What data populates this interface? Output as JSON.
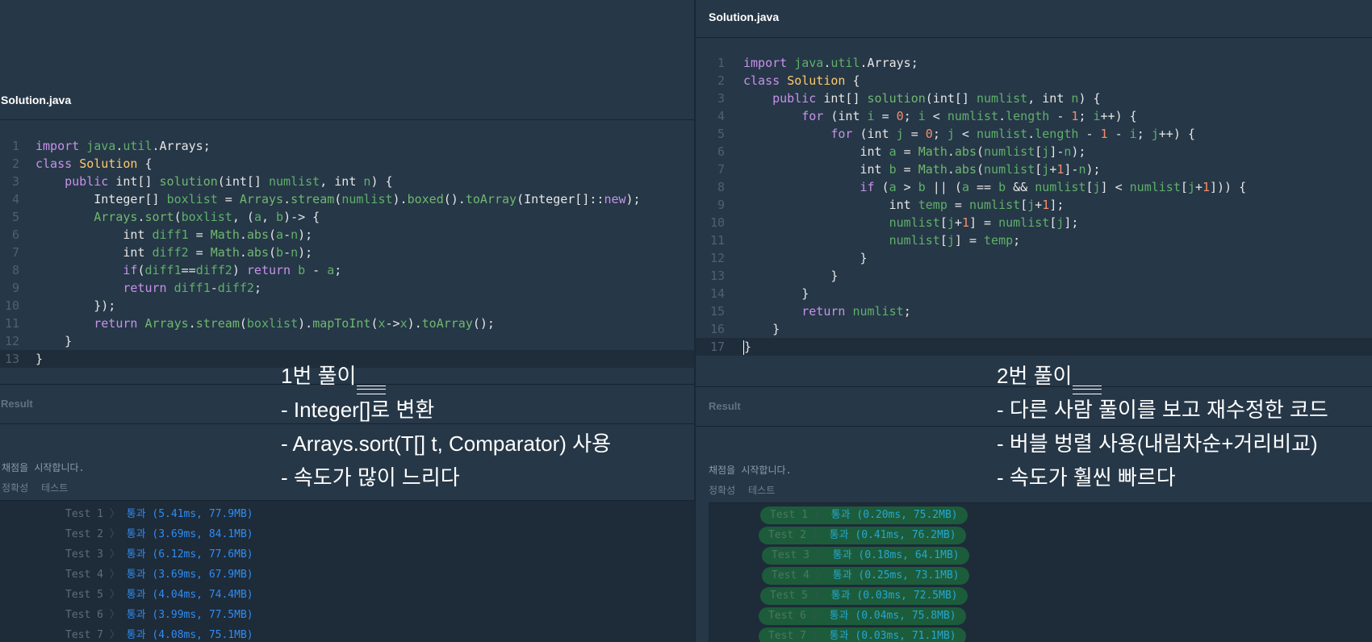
{
  "left": {
    "file_tab": "Solution.java",
    "line_numbers": [
      "1",
      "2",
      "3",
      "4",
      "5",
      "6",
      "7",
      "8",
      "9",
      "10",
      "11",
      "12",
      "13"
    ],
    "result_label": "Result",
    "grading_msg": "채점을 시작합니다.",
    "sub_tabs": [
      "정확성",
      "테스트"
    ],
    "tests": [
      {
        "name": "Test 1",
        "sep": "〉",
        "result": "통과 (5.41ms, 77.9MB)"
      },
      {
        "name": "Test 2",
        "sep": "〉",
        "result": "통과 (3.69ms, 84.1MB)"
      },
      {
        "name": "Test 3",
        "sep": "〉",
        "result": "통과 (6.12ms, 77.6MB)"
      },
      {
        "name": "Test 4",
        "sep": "〉",
        "result": "통과 (3.69ms, 67.9MB)"
      },
      {
        "name": "Test 5",
        "sep": "〉",
        "result": "통과 (4.04ms, 74.4MB)"
      },
      {
        "name": "Test 6",
        "sep": "〉",
        "result": "통과 (3.99ms, 77.5MB)"
      },
      {
        "name": "Test 7",
        "sep": "〉",
        "result": "통과 (4.08ms, 75.1MB)"
      }
    ],
    "annotation": [
      "1번 풀이",
      "- Integer[]로 변환",
      "- Arrays.sort(T[] t, Comparator) 사용",
      "- 속도가 많이 느리다"
    ]
  },
  "right": {
    "file_tab": "Solution.java",
    "line_numbers": [
      "1",
      "2",
      "3",
      "4",
      "5",
      "6",
      "7",
      "8",
      "9",
      "10",
      "11",
      "12",
      "13",
      "14",
      "15",
      "16",
      "17"
    ],
    "result_label": "Result",
    "grading_msg": "채점을 시작합니다.",
    "sub_tabs": [
      "정확성",
      "테스트"
    ],
    "tests": [
      {
        "name": "Test 1",
        "sep": "〉",
        "result": "통과 (0.20ms, 75.2MB)"
      },
      {
        "name": "Test 2",
        "sep": "〉",
        "result": "통과 (0.41ms, 76.2MB)"
      },
      {
        "name": "Test 3",
        "sep": "〉",
        "result": "통과 (0.18ms, 64.1MB)"
      },
      {
        "name": "Test 4",
        "sep": "〉",
        "result": "통과 (0.25ms, 73.1MB)"
      },
      {
        "name": "Test 5",
        "sep": "〉",
        "result": "통과 (0.03ms, 72.5MB)"
      },
      {
        "name": "Test 6",
        "sep": "〉",
        "result": "통과 (0.04ms, 75.8MB)"
      },
      {
        "name": "Test 7",
        "sep": "〉",
        "result": "통과 (0.03ms, 71.1MB)"
      }
    ],
    "annotation": [
      "2번 풀이",
      "- 다른 사람 풀이를 보고 재수정한 코드",
      "- 버블 벙렬 사용(내림차순+거리비교)",
      "- 속도가 훨씬 빠르다"
    ]
  }
}
